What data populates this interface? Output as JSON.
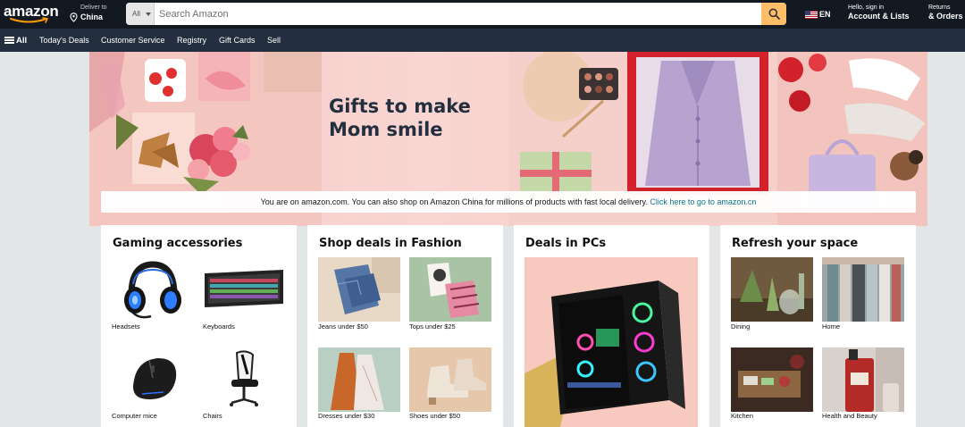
{
  "header": {
    "logo_text": "amazon",
    "deliver_line1": "Deliver to",
    "deliver_line2": "China",
    "search_category": "All",
    "search_placeholder": "Search Amazon",
    "language": "EN",
    "account_line1": "Hello, sign in",
    "account_line2": "Account & Lists",
    "returns_line1": "Returns",
    "returns_line2": "& Orders"
  },
  "subnav": {
    "all_label": "All",
    "items": [
      "Today's Deals",
      "Customer Service",
      "Registry",
      "Gift Cards",
      "Sell"
    ]
  },
  "hero": {
    "title_line1": "Gifts to make",
    "title_line2": "Mom smile",
    "notice_text": "You are on amazon.com. You can also shop on Amazon China for millions of products with fast local delivery.",
    "notice_link": "Click here to go to amazon.cn"
  },
  "cards": [
    {
      "title": "Gaming accessories",
      "tiles": [
        "Headsets",
        "Keyboards",
        "Computer mice",
        "Chairs"
      ]
    },
    {
      "title": "Shop deals in Fashion",
      "tiles": [
        "Jeans under $50",
        "Tops under $25",
        "Dresses under $30",
        "Shoes under $50"
      ]
    },
    {
      "title": "Deals in PCs"
    },
    {
      "title": "Refresh your space",
      "tiles": [
        "Dining",
        "Home",
        "Kitchen",
        "Health and Beauty"
      ]
    }
  ],
  "colors": {
    "nav_top": "#131921",
    "nav_sub": "#232f3e",
    "search_button": "#febd69",
    "link": "#007185",
    "page_bg": "#e3e6e6"
  }
}
